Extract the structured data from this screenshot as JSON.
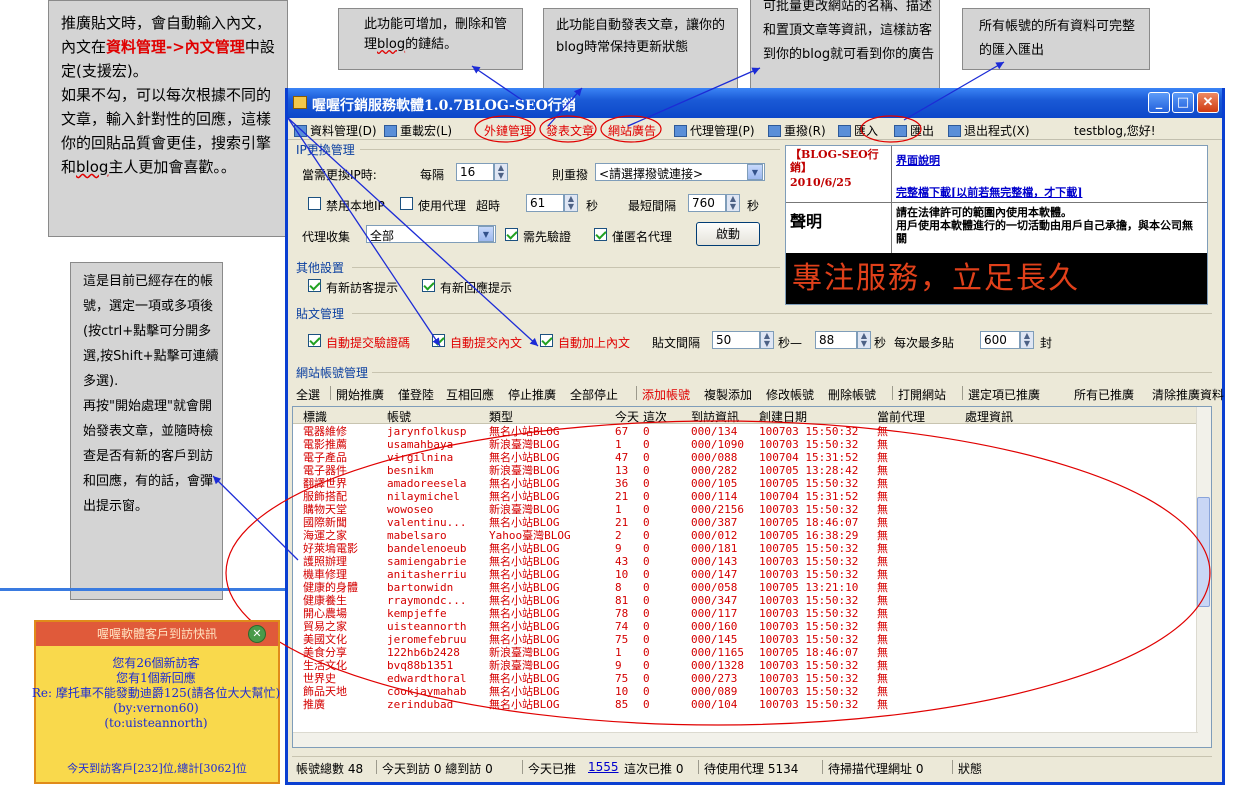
{
  "notes": {
    "n1_a": "推廣貼文時，會自動輸入內文，內文在",
    "n1_red1": "資料管理->內文管理",
    "n1_b": "中設定(支援宏)。\n如果不勾，可以每次根據不同的文章，輸入針對性的回應，這樣你的回貼品質會更佳，搜索引擎和",
    "n1_blog": "blog",
    "n1_c": "主人更加會喜歡。。",
    "n2_a": "此功能可增加，刪除和管理",
    "n2_blog": "blog",
    "n2_b": "的鏈結。",
    "n3": "此功能自動發表文章，讓你的blog時常保持更新狀態",
    "n4": "可批量更改網站的名稱、描述和置頂文章等資訊，這樣訪客到你的blog就可看到你的廣告",
    "n5": "所有帳號的所有資料可完整的匯入匯出",
    "n6": "這是目前已經存在的帳號，選定一項或多項後(按ctrl+點擊可分開多選,按Shift+點擊可連續多選).\n再按\"開始處理\"就會開始發表文章，並隨時檢查是否有新的客戶到訪和回應，有的話，會彈出提示窗。"
  },
  "window": {
    "title": "喔喔行銷服務軟體1.0.7BLOG-SEO行銷",
    "menu": [
      "資料管理(D)",
      "重載宏(L)",
      "外鏈管理",
      "發表文章",
      "網站廣告",
      "代理管理(P)",
      "重撥(R)",
      "匯入",
      "匯出",
      "退出程式(X)"
    ],
    "greeting": "testblog,您好!"
  },
  "ip_group": {
    "label": "IP更換管理",
    "needs_change": "當需更換IP時:",
    "every": "每隔",
    "every_value": "16",
    "redial": "則重撥",
    "redial_select": "<請選擇撥號連接>",
    "no_local_ip": "禁用本地IP",
    "use_proxy": "使用代理",
    "timeout": "超時",
    "timeout_value": "61",
    "seconds": "秒",
    "min_interval": "最短間隔",
    "min_interval_value": "760",
    "seconds2": "秒",
    "proxy_collect": "代理收集",
    "proxy_collect_value": "全部",
    "need_verify": "需先驗證",
    "anon_only": "僅匿名代理",
    "start_btn": "啟動"
  },
  "info": {
    "tag": "【BLOG-SEO行銷】",
    "date": "2010/6/25",
    "link1": "界面說明",
    "link2": "完整檔下載[以前若無完整檔，才下載]",
    "decl_label": "聲明",
    "decl_text": "請在法律許可的範圍內使用本軟體。\n用戶使用本軟體進行的一切活動由用戶自己承擔，與本公司無關",
    "slogan": "專注服務，立足長久"
  },
  "other_group": {
    "label": "其他設置",
    "new_visitor": "有新訪客提示",
    "new_reply": "有新回應提示"
  },
  "post_group": {
    "label": "貼文管理",
    "auto_captcha": "自動提交驗證碼",
    "auto_content": "自動提交內文",
    "auto_add": "自動加上內文",
    "interval": "貼文間隔",
    "interval_from": "50",
    "sec_to": "秒—",
    "interval_to": "88",
    "sec": "秒",
    "max_per": "每次最多貼",
    "max_value": "600",
    "unit": "封"
  },
  "account_group": {
    "label": "網站帳號管理",
    "toolbar": [
      "全選",
      "開始推廣",
      "僅登陸",
      "互相回應",
      "停止推廣",
      "全部停止",
      "添加帳號",
      "複製添加",
      "修改帳號",
      "刪除帳號",
      "打開網站",
      "選定項已推廣",
      "所有已推廣",
      "清除推廣資料"
    ],
    "columns": [
      "標識",
      "帳號",
      "類型",
      "今天",
      "這次",
      "到訪資訊",
      "創建日期",
      "當前代理",
      "處理資訊"
    ],
    "rows": [
      [
        "電器維修",
        "jarynfolkusp",
        "無名小站BLOG",
        "67",
        "0",
        "000/134",
        "100703 15:50:32",
        "無"
      ],
      [
        "電影推薦",
        "usamahbaya",
        "新浪臺灣BLOG",
        "1",
        "0",
        "000/1090",
        "100703 15:50:32",
        "無"
      ],
      [
        "電子產品",
        "virgilnina",
        "無名小站BLOG",
        "47",
        "0",
        "000/088",
        "100704 15:31:52",
        "無"
      ],
      [
        "電子器件",
        "besnikm",
        "新浪臺灣BLOG",
        "13",
        "0",
        "000/282",
        "100705 13:28:42",
        "無"
      ],
      [
        "翻譯世界",
        "amadoreesela",
        "無名小站BLOG",
        "36",
        "0",
        "000/105",
        "100705 15:50:32",
        "無"
      ],
      [
        "服飾搭配",
        "nilaymichel",
        "無名小站BLOG",
        "21",
        "0",
        "000/114",
        "100704 15:31:52",
        "無"
      ],
      [
        "購物天堂",
        "wowoseo",
        "新浪臺灣BLOG",
        "1",
        "0",
        "000/2156",
        "100703 15:50:32",
        "無"
      ],
      [
        "國際新聞",
        "valentinu...",
        "無名小站BLOG",
        "21",
        "0",
        "000/387",
        "100705 18:46:07",
        "無"
      ],
      [
        "海運之家",
        "mabelsaro",
        "Yahoo臺灣BLOG",
        "2",
        "0",
        "000/012",
        "100705 16:38:29",
        "無"
      ],
      [
        "好萊塢電影",
        "bandelenoeub",
        "無名小站BLOG",
        "9",
        "0",
        "000/181",
        "100705 15:50:32",
        "無"
      ],
      [
        "護照辦理",
        "samiengabrie",
        "無名小站BLOG",
        "43",
        "0",
        "000/143",
        "100703 15:50:32",
        "無"
      ],
      [
        "機車修理",
        "anitasherriu",
        "無名小站BLOG",
        "10",
        "0",
        "000/147",
        "100703 15:50:32",
        "無"
      ],
      [
        "健康的身體",
        "bartonwidn",
        "無名小站BLOG",
        "8",
        "0",
        "000/058",
        "100705 13:21:10",
        "無"
      ],
      [
        "健康養生",
        "rraymondc...",
        "無名小站BLOG",
        "81",
        "0",
        "000/347",
        "100703 15:50:32",
        "無"
      ],
      [
        "開心農場",
        "kempjeffe",
        "無名小站BLOG",
        "78",
        "0",
        "000/117",
        "100703 15:50:32",
        "無"
      ],
      [
        "貿易之家",
        "uisteannorth",
        "無名小站BLOG",
        "74",
        "0",
        "000/160",
        "100703 15:50:32",
        "無"
      ],
      [
        "美國文化",
        "jeromefebruu",
        "無名小站BLOG",
        "75",
        "0",
        "000/145",
        "100703 15:50:32",
        "無"
      ],
      [
        "美食分享",
        "122hb6b2428",
        "新浪臺灣BLOG",
        "1",
        "0",
        "000/1165",
        "100705 18:46:07",
        "無"
      ],
      [
        "生活文化",
        "bvq88b1351",
        "新浪臺灣BLOG",
        "9",
        "0",
        "000/1328",
        "100703 15:50:32",
        "無"
      ],
      [
        "世界史",
        "edwardthoral",
        "無名小站BLOG",
        "75",
        "0",
        "000/273",
        "100703 15:50:32",
        "無"
      ],
      [
        "飾品天地",
        "cookjaymahab",
        "無名小站BLOG",
        "10",
        "0",
        "000/089",
        "100703 15:50:32",
        "無"
      ],
      [
        "推廣",
        "zerindubad",
        "無名小站BLOG",
        "85",
        "0",
        "000/104",
        "100703 15:50:32",
        "無"
      ]
    ]
  },
  "status": {
    "total": "帳號總數 48",
    "today_visit": "今天到訪 0 總到訪 0",
    "today_pushed_label": "今天已推",
    "today_pushed_value": "1555",
    "this_pushed": "這次已推 0",
    "proxy_pending": "待使用代理 5134",
    "proxy_scan": "待掃描代理網址 0",
    "state": "狀態"
  },
  "popup": {
    "title": "喔喔軟體客戶到訪快訊",
    "body": "您有26個新訪客\n您有1個新回應\nRe: 摩托車不能發動迪爵125(請各位大大幫忙) (by:vernon60)\n(to:uisteannorth)",
    "footer": "今天到訪客戶[232]位,總計[3062]位"
  },
  "colors": {
    "accent_red": "#e00000",
    "title_blue": "#1a5ad6",
    "popup_yellow": "#f9d94c",
    "popup_header": "#e05a3a"
  }
}
